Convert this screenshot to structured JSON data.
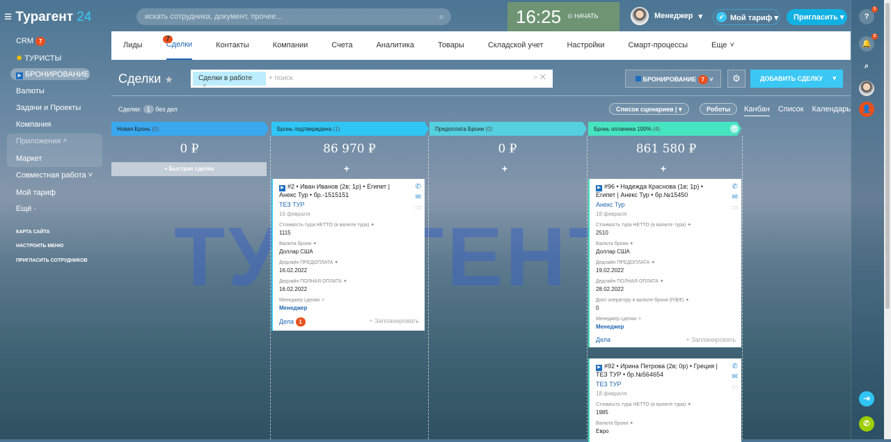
{
  "header": {
    "logo_name": "Турагент",
    "logo_num": "24",
    "search_placeholder": "искать сотрудника, документ, прочее...",
    "time": "16:25",
    "start": "НАЧАТЬ",
    "user": "Менеджер",
    "tariff": "Мой тариф",
    "invite": "Пригласить"
  },
  "sidebar": {
    "crm": "CRM",
    "crm_badge": "7",
    "tourists": "ТУРИСТЫ",
    "booking": "БРОНИРОВАНИЕ",
    "items": [
      "Валюты",
      "Задачи и Проекты",
      "Компания"
    ],
    "apps": "Приложения",
    "market": "Маркет",
    "collab": "Совместная работа",
    "my_tariff": "Мой тариф",
    "more": "Ещё",
    "links": [
      "КАРТА САЙТА",
      "НАСТРОИТЬ МЕНЮ",
      "ПРИГЛАСИТЬ СОТРУДНИКОВ"
    ]
  },
  "nav": {
    "tabs": [
      "Лиды",
      "Сделки",
      "Контакты",
      "Компании",
      "Счета",
      "Аналитика",
      "Товары",
      "Складской учет",
      "Настройки",
      "Смарт-процессы",
      "Еще"
    ],
    "deals_badge": "7"
  },
  "toolbar": {
    "title": "Сделки",
    "filter_chip": "Сделки в работе",
    "search_placeholder": "+ поиск",
    "category": "БРОНИРОВАНИЕ",
    "category_badge": "7",
    "add_deal": "ДОБАВИТЬ СДЕЛКУ",
    "count_label": "Сделки:",
    "count": "1",
    "count_suffix": "без дел",
    "scenarios": "Список сценариев",
    "robots": "Роботы",
    "views": [
      "Канбан",
      "Список",
      "Календарь"
    ]
  },
  "watermark": "ТУРАГЕНТ",
  "columns": [
    {
      "title": "Новая Бронь",
      "count": "(0)",
      "sum": "0 ₽",
      "color": "#39a8ef"
    },
    {
      "title": "Бронь подтверждена",
      "count": "(1)",
      "sum": "86 970 ₽",
      "color": "#2fc6f6"
    },
    {
      "title": "Предоплата Брони",
      "count": "(0)",
      "sum": "0 ₽",
      "color": "#55d0e0"
    },
    {
      "title": "Бронь оплачена 100%",
      "count": "(4)",
      "sum": "861 580 ₽",
      "color": "#47e4c2"
    }
  ],
  "quick_deal": "+ Быстрая сделка",
  "cards": [
    {
      "title": "#2 • Иван Иванов (2в; 1р) • Египет | Анекс Тур • бр.-1515151",
      "company": "ТЕЗ ТУР",
      "date": "16 февраля",
      "fields": [
        [
          "Стоимость тура НЕТТО (в валюте тура)",
          "1115"
        ],
        [
          "Валюта брони",
          "Доллар США"
        ],
        [
          "Дедлайн ПРЕДОПЛАТА",
          "16.02.2022"
        ],
        [
          "Дедлайн ПОЛНАЯ ОПЛАТА",
          "16.02.2022"
        ]
      ],
      "manager_label": "Менеджер сделки",
      "manager": "Менеджер",
      "tasks": "Дела",
      "tasks_badge": "1",
      "plan": "+ Запланировать"
    },
    {
      "title": "#96 • Надежда Краснова (1в; 1р) • Египет | Анекс Тур • бр.№15450",
      "company": "Анекс Тур",
      "date": "18 февраля",
      "fields": [
        [
          "Стоимость тура НЕТТО (в валюте тура)",
          "2510"
        ],
        [
          "Валюта брони",
          "Доллар США"
        ],
        [
          "Дедлайн ПРЕДОПЛАТА",
          "19.02.2022"
        ],
        [
          "Дедлайн ПОЛНАЯ ОПЛАТА",
          "28.02.2022"
        ],
        [
          "Долг оператору в валюте брони (Р/$/€)",
          "0"
        ]
      ],
      "manager_label": "Менеджер сделки",
      "manager": "Менеджер",
      "tasks": "Дела",
      "plan": "+ Запланировать"
    },
    {
      "title": "#92 • Ирина Петрова (2в; 0р) • Греция | ТЕЗ ТУР • бр.№564654",
      "company": "ТЕЗ ТУР",
      "date": "18 февраля",
      "fields": [
        [
          "Стоимость тура НЕТТО (в валюте тура)",
          "1985"
        ],
        [
          "Валюта брони",
          "Евро"
        ]
      ]
    }
  ],
  "rightbar": {
    "help_badge": "1",
    "notif_badge": "2"
  }
}
